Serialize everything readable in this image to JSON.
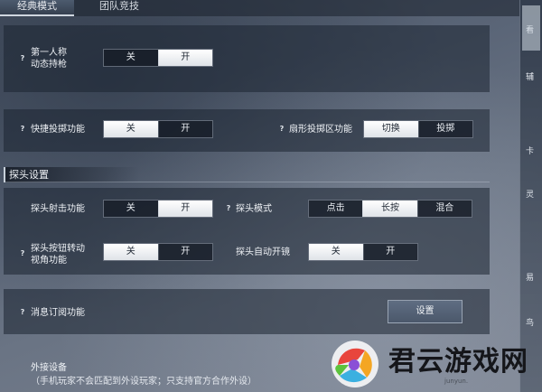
{
  "tabs": [
    "经典模式",
    "团队竞技"
  ],
  "rows": {
    "first_person": {
      "help": "?",
      "label_line1": "第一人称",
      "label_line2": "动态持枪",
      "options": [
        "关",
        "开"
      ],
      "selected": 1
    },
    "quick_throw": {
      "help": "?",
      "label": "快捷投掷功能",
      "options": [
        "关",
        "开"
      ],
      "selected": 0
    },
    "fan_throw": {
      "help": "?",
      "label": "扇形投掷区功能",
      "options": [
        "切换",
        "投掷"
      ],
      "selected": 0
    }
  },
  "peek_section": {
    "title": "探头设置",
    "peek_shoot": {
      "label": "探头射击功能",
      "options": [
        "关",
        "开"
      ],
      "selected": 1
    },
    "peek_mode": {
      "help": "?",
      "label": "探头模式",
      "options": [
        "点击",
        "长按",
        "混合"
      ],
      "selected": 1
    },
    "peek_button_rotate": {
      "help": "?",
      "label_line1": "探头按钮转动",
      "label_line2": "视角功能",
      "options": [
        "关",
        "开"
      ],
      "selected": 0
    },
    "peek_auto_scope": {
      "label": "探头自动开镜",
      "options": [
        "关",
        "开"
      ],
      "selected": 0
    }
  },
  "message_subscription": {
    "help": "?",
    "label": "消息订阅功能",
    "button": "设置"
  },
  "external_device": {
    "title": "外接设备",
    "note": "（手机玩家不会匹配到外设玩家；只支持官方合作外设）"
  },
  "right_strip_chars": [
    "看",
    "辅",
    "卡",
    "灵",
    "易",
    "鸟"
  ],
  "watermark": {
    "text": "君云游戏网",
    "sub": "junyun.",
    "colors": [
      "#e8453c",
      "#f4a623",
      "#3bb0e0",
      "#5cc23c",
      "#8a4fd6"
    ]
  }
}
